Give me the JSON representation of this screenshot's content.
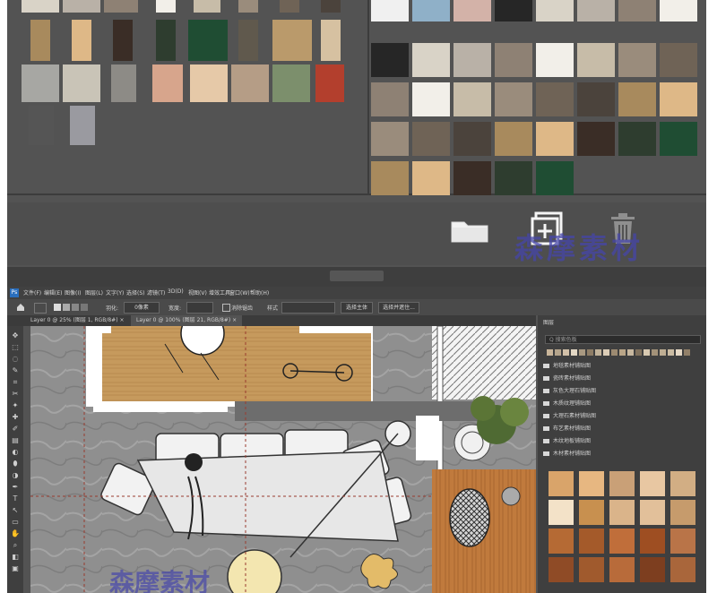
{
  "watermark": {
    "text": "森摩素材"
  },
  "library": {
    "actions": {
      "new_group_icon": "folder-icon",
      "add_icon": "add-square-icon",
      "delete_icon": "trash-icon"
    },
    "swatch_colors": [
      "#d9d3c7",
      "#b9b1a7",
      "#8e8174",
      "#f2efe9",
      "#c7bca8",
      "#9a8c7c",
      "#6f6356",
      "#4b433c",
      "#a88a5d",
      "#deb887",
      "#3a2d26",
      "#2e3d2f",
      "#1f4d33",
      "#60594d",
      "#ba9a6b",
      "#d6c1a1",
      "#a7a7a3",
      "#c9c4b7",
      "#8d8b86",
      "#d7a58c",
      "#e6c9a8",
      "#b59d86",
      "#7c8f6c",
      "#b33f2d",
      "#555555",
      "#9a9aa0",
      "#f0f0f0",
      "#8fb0c8",
      "#d3b2a8",
      "#262626"
    ]
  },
  "menubar": {
    "app_icon": "ps-logo-icon",
    "items": [
      "文件(F)",
      "编辑(E)",
      "图像(I)",
      "图层(L)",
      "文字(Y)",
      "选择(S)",
      "滤镜(T)",
      "3D(D)",
      "视图(V)",
      "增效工具",
      "窗口(W)",
      "帮助(H)"
    ]
  },
  "options": {
    "home_icon": "home-icon",
    "feather_label": "羽化:",
    "feather_value": "0像素",
    "width_label": "宽度:",
    "antialias_label": "消除锯齿",
    "style_label": "样式",
    "select_subject": "选择并遮住...",
    "select_and_mask": "选择主体",
    "extra": "选择并遮住..."
  },
  "tabs": [
    {
      "label": "Layer 0 @ 25% (图层 1, RGB/8#) ×"
    },
    {
      "label": "Layer 0 @ 100% (图层 21, RGB/8#) ×"
    }
  ],
  "layers_panel": {
    "title": "图层",
    "search_placeholder": "Q 搜索色板",
    "groups": [
      "地毯素材铺贴图",
      "瓷砖素材铺贴图",
      "灰色大理石铺贴图",
      "木质纹理铺贴图",
      "大理石素材铺贴图",
      "布艺素材铺贴图",
      "木纹地板铺贴图",
      "木材素材铺贴图"
    ]
  }
}
